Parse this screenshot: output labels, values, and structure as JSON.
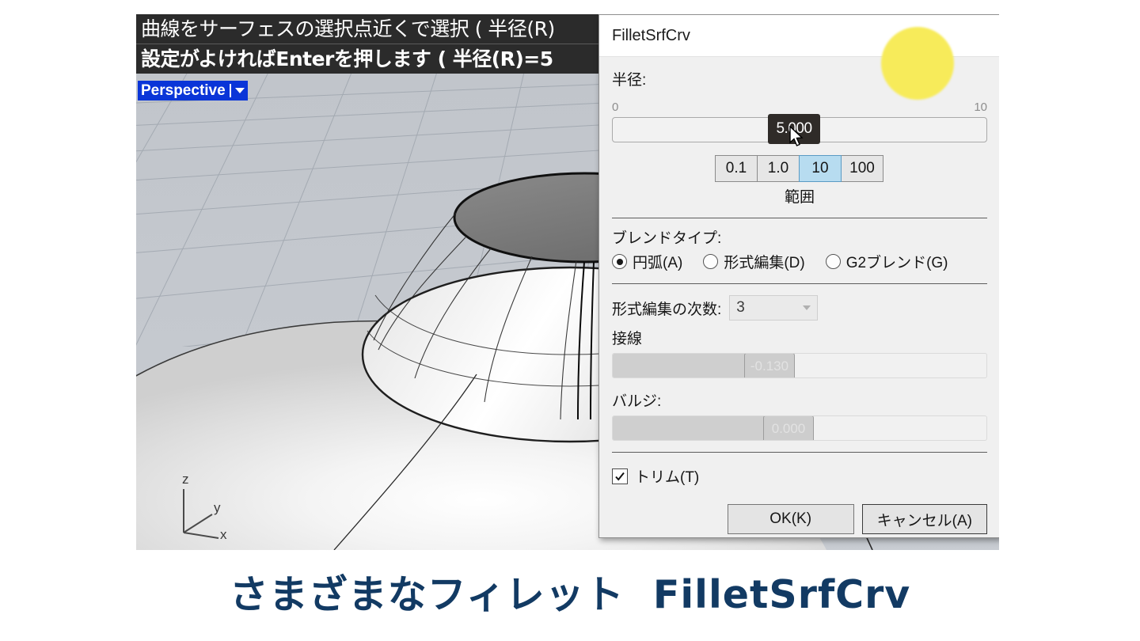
{
  "app": {
    "command_line": {
      "line1": "曲線をサーフェスの選択点近くで選択 ( 半径(R)",
      "line2": "設定がよければEnterを押します ( 半径(R)=5"
    },
    "viewport": {
      "title": "Perspective",
      "axis_z": "z",
      "axis_y": "y",
      "axis_x": "x"
    }
  },
  "dialog": {
    "title": "FilletSrfCrv",
    "radius": {
      "label": "半径:",
      "min": "0",
      "max": "10",
      "value": "5.000",
      "value_number": 5.0,
      "range_buttons": [
        {
          "label": "0.1",
          "selected": false
        },
        {
          "label": "1.0",
          "selected": false
        },
        {
          "label": "10",
          "selected": true
        },
        {
          "label": "100",
          "selected": false
        }
      ],
      "range_caption": "範囲"
    },
    "blend_type": {
      "label": "ブレンドタイプ:",
      "options": [
        {
          "label": "円弧(A)",
          "selected": true
        },
        {
          "label": "形式編集(D)",
          "selected": false
        },
        {
          "label": "G2ブレンド(G)",
          "selected": false
        }
      ]
    },
    "degree": {
      "label": "形式編集の次数:",
      "value": "3"
    },
    "tangent": {
      "label": "接線",
      "value": "-0.130"
    },
    "bulge": {
      "label": "バルジ:",
      "value": "0.000"
    },
    "trim": {
      "label": "トリム(T)",
      "checked": true
    },
    "buttons": {
      "ok": "OK(K)",
      "cancel": "キャンセル(A)"
    }
  },
  "caption": {
    "text": "さまざまなフィレット  FilletSrfCrv"
  },
  "colors": {
    "caption": "#123a63",
    "viewport_title_bg": "#0a35d8",
    "range_selected": "#b7dcf0",
    "highlight_circle": "#f7eb5a",
    "command_bg": "#2b2b2b"
  }
}
